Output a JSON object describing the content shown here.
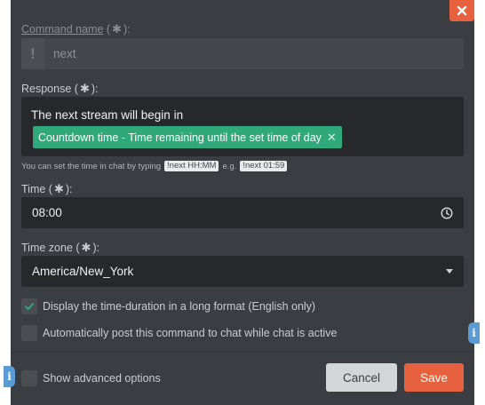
{
  "dialog": {
    "close_icon": "close-icon",
    "command_name": {
      "label": "Command name",
      "required_mark": "✱",
      "prefix": "!",
      "value": "next"
    },
    "response": {
      "label": "Response",
      "required_mark": "✱",
      "text": "The next stream will begin in",
      "tag": {
        "label": "Countdown time - Time remaining until the set time of day",
        "remove_icon": "✕"
      }
    },
    "hint": {
      "before": "You can set the time in chat by typing",
      "code1": "!next HH:MM",
      "middle": "e.g.",
      "code2": "!next 01:59"
    },
    "time": {
      "label": "Time",
      "required_mark": "✱",
      "value": "08:00",
      "icon": "clock-icon"
    },
    "timezone": {
      "label": "Time zone",
      "required_mark": "✱",
      "value": "America/New_York",
      "icon": "caret-down-icon"
    },
    "options": {
      "long_format": {
        "label": "Display the time-duration in a long format (English only)",
        "checked": true
      },
      "auto_post": {
        "label": "Automatically post this command to chat while chat is active",
        "checked": false
      },
      "advanced": {
        "label": "Show advanced options",
        "checked": false
      }
    },
    "buttons": {
      "cancel": "Cancel",
      "save": "Save"
    },
    "info_glyph": "i"
  },
  "colors": {
    "accent": "#e8613f",
    "tag_green": "#2fa87a",
    "info_blue": "#5a9bd3",
    "panel": "#3a3d42",
    "field_dark": "#26282c"
  }
}
